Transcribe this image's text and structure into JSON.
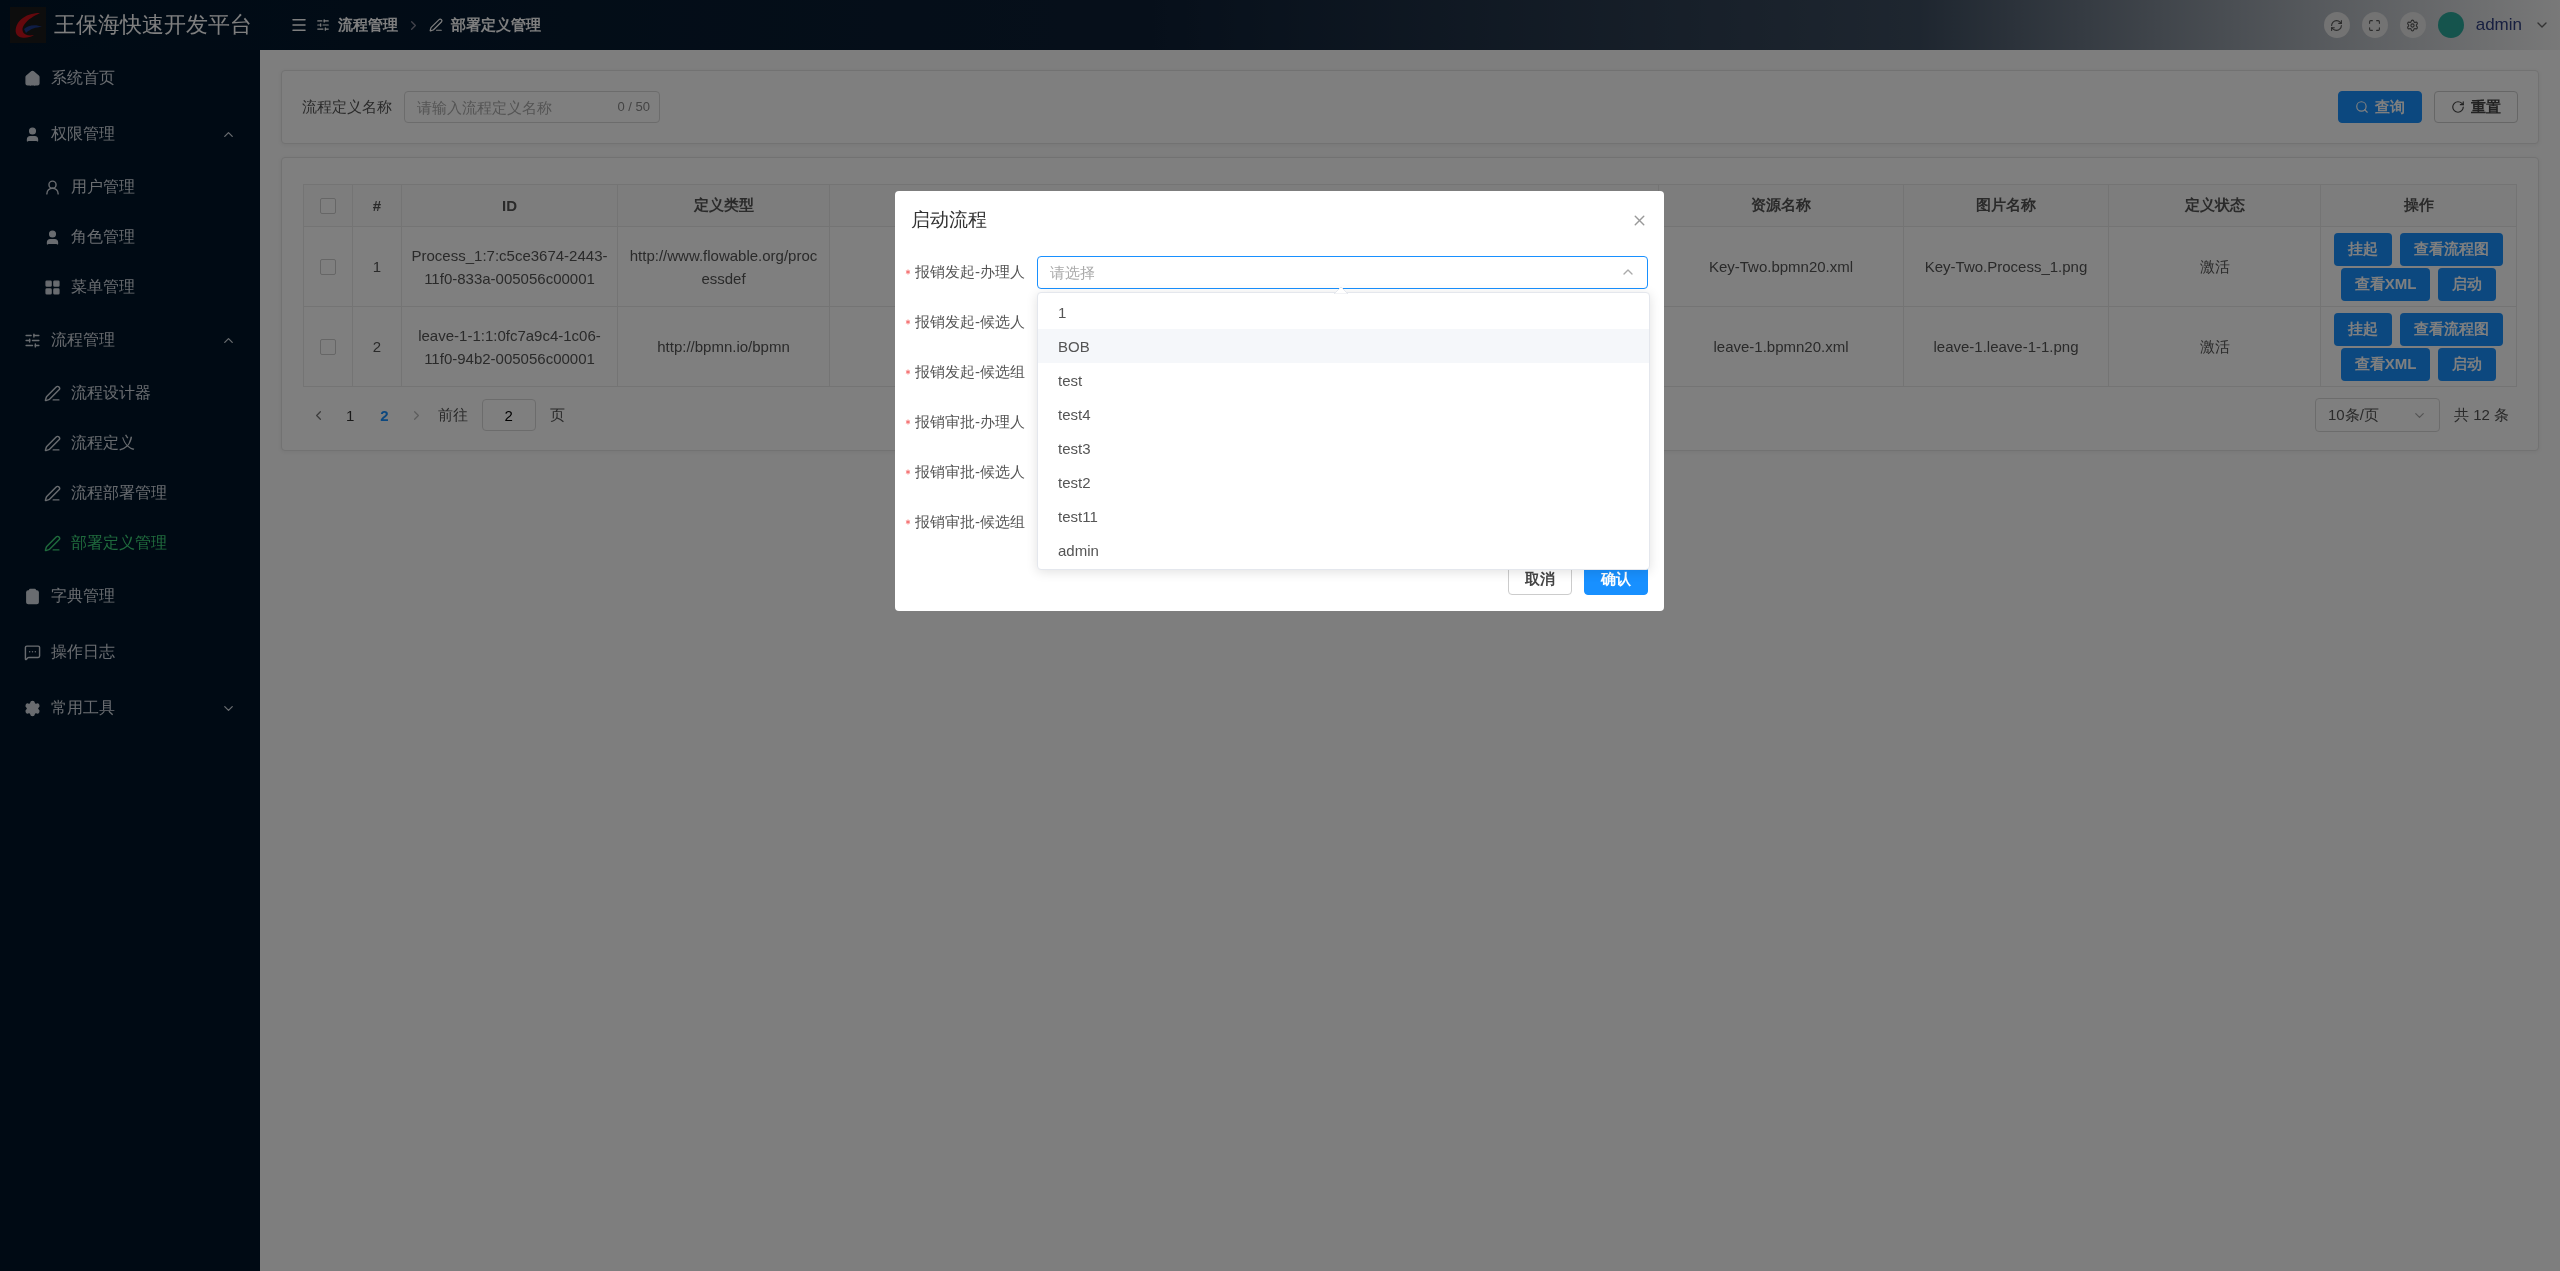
{
  "app": {
    "title": "王保海快速开发平台"
  },
  "breadcrumb": [
    {
      "label": "流程管理"
    },
    {
      "label": "部署定义管理"
    }
  ],
  "user": {
    "name": "admin"
  },
  "sidebar": {
    "items": [
      {
        "label": "系统首页",
        "selected": false
      },
      {
        "label": "权限管理",
        "selected": false,
        "expanded": true,
        "children": [
          {
            "label": "用户管理",
            "selected": false
          },
          {
            "label": "角色管理",
            "selected": false
          },
          {
            "label": "菜单管理",
            "selected": false
          }
        ]
      },
      {
        "label": "流程管理",
        "selected": false,
        "expanded": true,
        "children": [
          {
            "label": "流程设计器",
            "selected": false
          },
          {
            "label": "流程定义",
            "selected": false
          },
          {
            "label": "流程部署管理",
            "selected": false
          },
          {
            "label": "部署定义管理",
            "selected": true
          }
        ]
      },
      {
        "label": "字典管理",
        "selected": false
      },
      {
        "label": "操作日志",
        "selected": false
      },
      {
        "label": "常用工具",
        "selected": false,
        "expanded": false
      }
    ]
  },
  "search": {
    "label": "流程定义名称",
    "placeholder": "请输入流程定义名称",
    "counter": "0 / 50",
    "buttons": [
      {
        "kind": "primary",
        "label": "查询"
      },
      {
        "kind": "default",
        "label": "重置"
      }
    ]
  },
  "table": {
    "select_all_checked": false,
    "columns": [
      "#",
      "ID",
      "定义类型",
      "资源名称",
      "图片名称",
      "定义状态",
      "操作"
    ],
    "rows": [
      {
        "checked": false,
        "index": "1",
        "id": "Process_1:7:c5ce3674-2443-11f0-833a-005056c00001",
        "type": "http://www.flowable.org/processdef",
        "resource": "Key-Two.bpmn20.xml",
        "image": "Key-Two.Process_1.png",
        "status": "激活",
        "actions": [
          "挂起",
          "查看流程图",
          "查看XML",
          "启动"
        ]
      },
      {
        "checked": false,
        "index": "2",
        "id": "leave-1-1:1:0fc7a9c4-1c06-11f0-94b2-005056c00001",
        "type": "http://bpmn.io/bpmn",
        "resource": "leave-1.bpmn20.xml",
        "image": "leave-1.leave-1-1.png",
        "status": "激活",
        "actions": [
          "挂起",
          "查看流程图",
          "查看XML",
          "启动"
        ]
      }
    ]
  },
  "pagination": {
    "pages": [
      {
        "label": "1",
        "selected": false
      },
      {
        "label": "2",
        "selected": true
      }
    ],
    "goto_label": "前往",
    "goto_value": "2",
    "goto_suffix": "页",
    "page_size": "10条/页",
    "total": "共 12 条"
  },
  "dialog": {
    "title": "启动流程",
    "fields": [
      {
        "label": "报销发起-办理人",
        "required": true,
        "placeholder": "请选择",
        "expanded": true,
        "options": [
          {
            "label": "1",
            "highlighted": false
          },
          {
            "label": "BOB",
            "highlighted": true
          },
          {
            "label": "test",
            "highlighted": false
          },
          {
            "label": "test4",
            "highlighted": false
          },
          {
            "label": "test3",
            "highlighted": false
          },
          {
            "label": "test2",
            "highlighted": false
          },
          {
            "label": "test11",
            "highlighted": false
          },
          {
            "label": "admin",
            "highlighted": false
          }
        ]
      },
      {
        "label": "报销发起-候选人",
        "required": true
      },
      {
        "label": "报销发起-候选组",
        "required": true
      },
      {
        "label": "报销审批-办理人",
        "required": true
      },
      {
        "label": "报销审批-候选人",
        "required": true
      },
      {
        "label": "报销审批-候选组",
        "required": true
      }
    ],
    "buttons": [
      {
        "kind": "default",
        "label": "取消"
      },
      {
        "kind": "primary",
        "label": "确认"
      }
    ]
  }
}
